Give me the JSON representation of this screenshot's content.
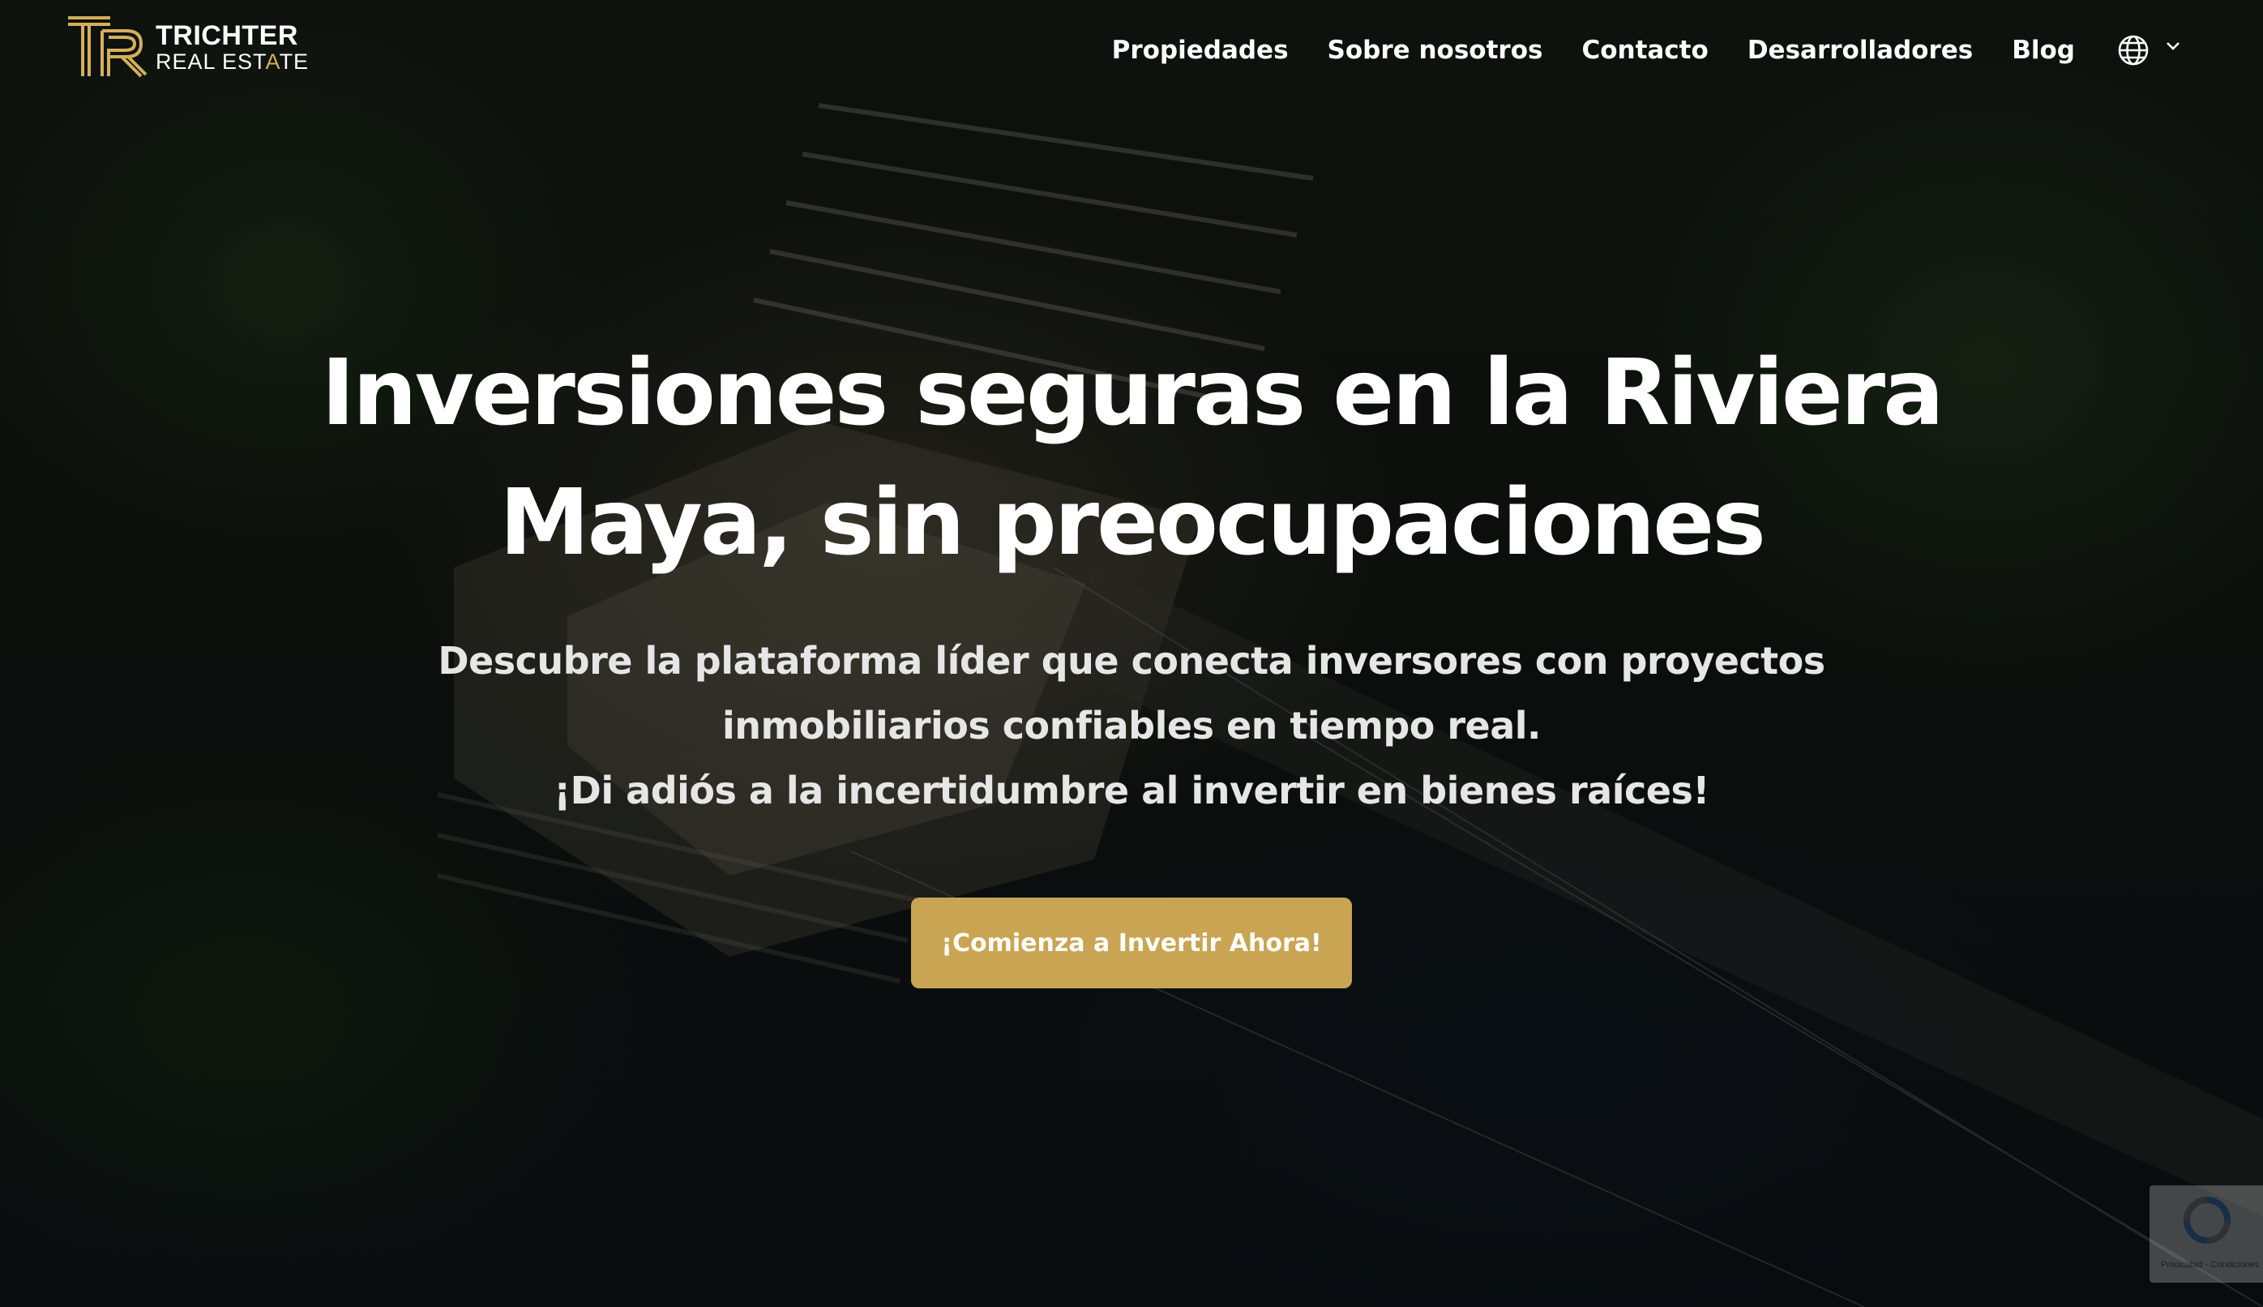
{
  "brand": {
    "name": "TRICHTER",
    "sub_prefix": "REAL EST",
    "sub_accent": "A",
    "sub_suffix": "TE",
    "monogram": "TR",
    "accent_color": "#c9a452"
  },
  "nav": {
    "items": [
      {
        "label": "Propiedades"
      },
      {
        "label": "Sobre nosotros"
      },
      {
        "label": "Contacto"
      },
      {
        "label": "Desarrolladores"
      },
      {
        "label": "Blog"
      }
    ],
    "language_icon": "globe-icon",
    "dropdown_icon": "chevron-down-icon"
  },
  "hero": {
    "title_line1": "Inversiones seguras en la Riviera",
    "title_line2": "Maya, sin preocupaciones",
    "subtitle_line1": "Descubre la plataforma líder que conecta inversores con proyectos",
    "subtitle_line2": "inmobiliarios confiables en tiempo real.",
    "subtitle_line3": "¡Di adiós a la incertidumbre al invertir en bienes raíces!",
    "cta_label": "¡Comienza a Invertir Ahora!"
  },
  "recaptcha": {
    "links": "Privacidad - Condiciones",
    "icon": "recaptcha-icon"
  }
}
